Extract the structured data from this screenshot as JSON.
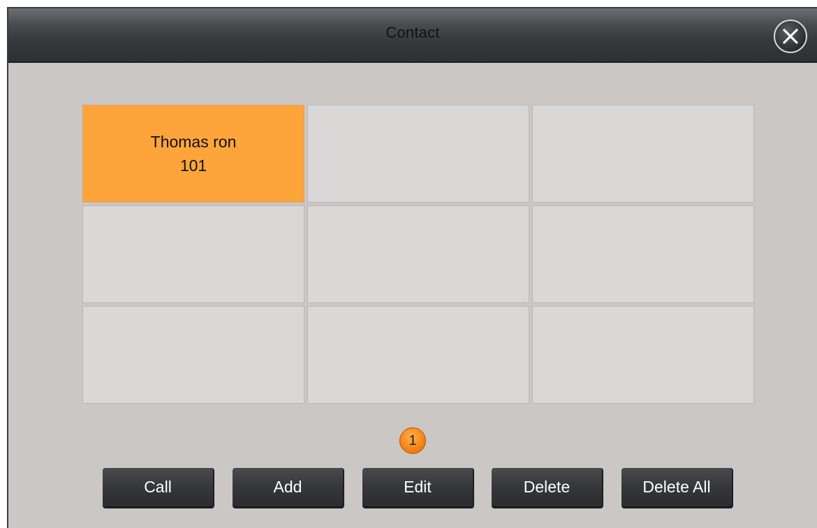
{
  "window": {
    "title": "Contact"
  },
  "contacts": [
    {
      "name": "Thomas ron",
      "number": "101",
      "selected": true
    },
    {
      "name": "",
      "number": ""
    },
    {
      "name": "",
      "number": ""
    },
    {
      "name": "",
      "number": ""
    },
    {
      "name": "",
      "number": ""
    },
    {
      "name": "",
      "number": ""
    },
    {
      "name": "",
      "number": ""
    },
    {
      "name": "",
      "number": ""
    },
    {
      "name": "",
      "number": ""
    }
  ],
  "pagination": {
    "current_page": "1"
  },
  "actions": {
    "call": "Call",
    "add": "Add",
    "edit": "Edit",
    "delete": "Delete",
    "delete_all": "Delete All"
  },
  "icons": {
    "close": "close-icon"
  },
  "colors": {
    "selected": "#fda53a",
    "badge": "#f0780a"
  }
}
